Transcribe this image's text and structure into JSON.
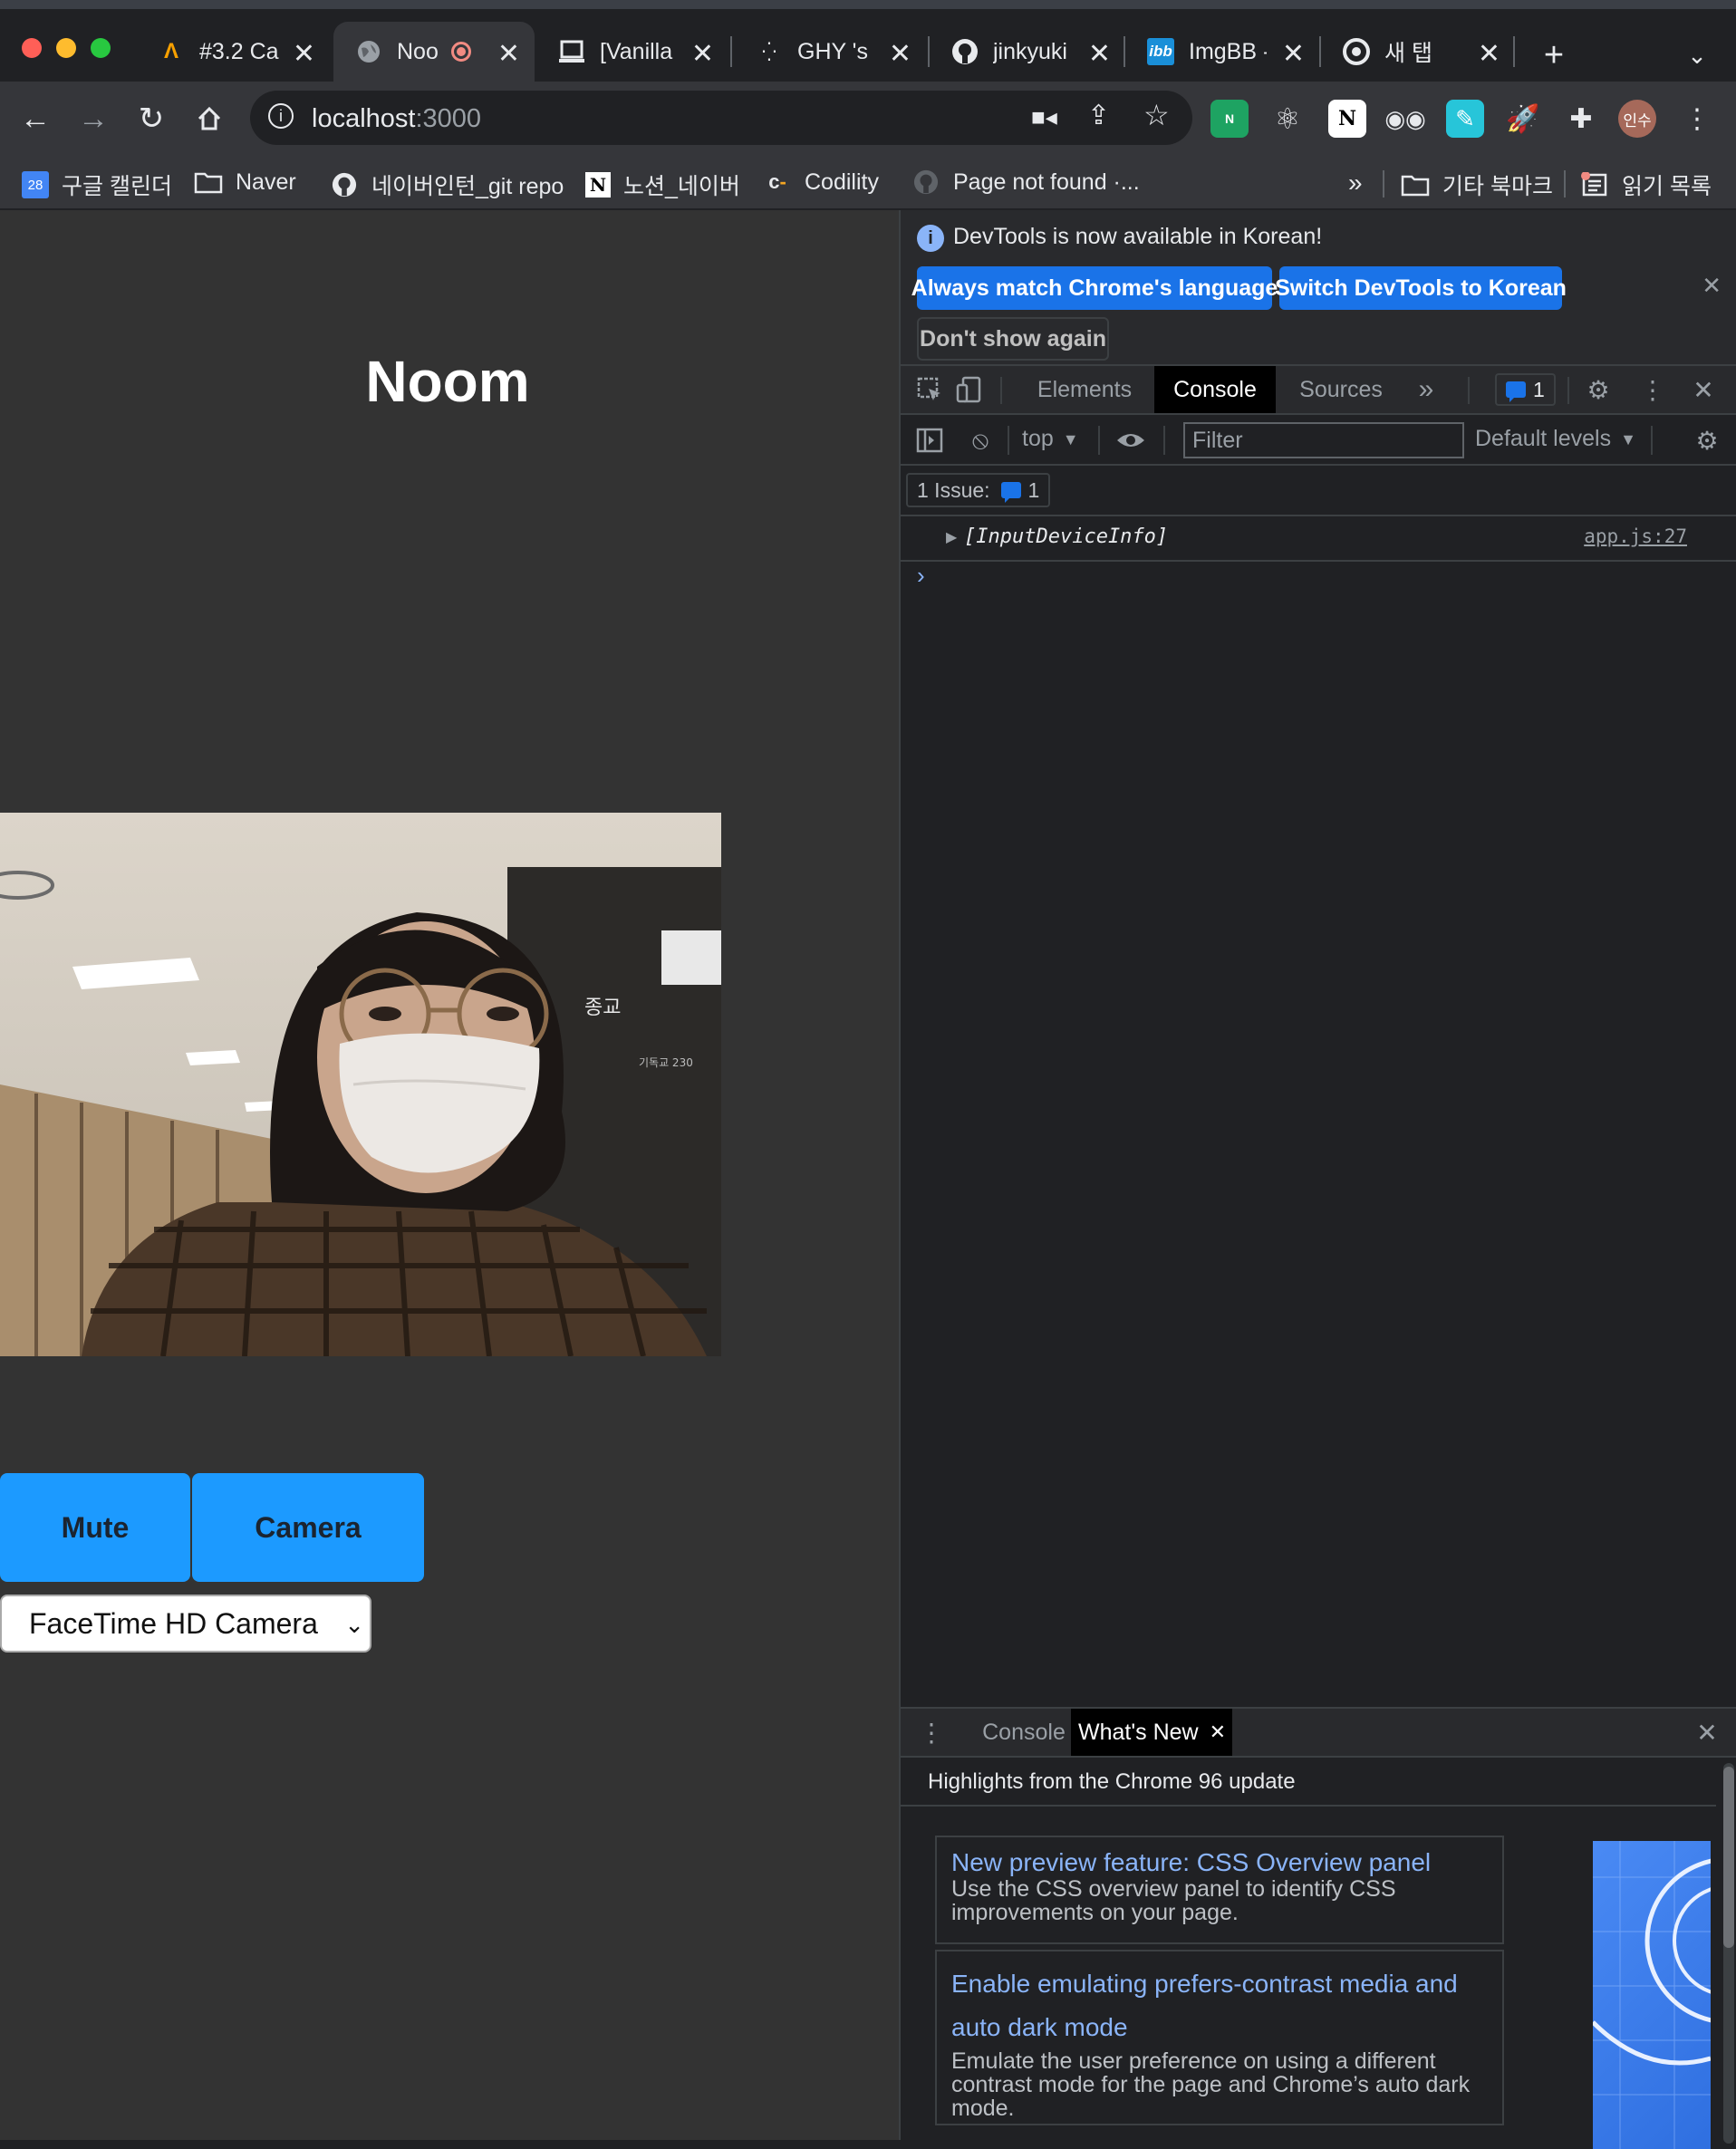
{
  "browser": {
    "tabs": [
      {
        "title": "#3.2 Ca",
        "icon": "m-logo-icon"
      },
      {
        "title": "Noo",
        "icon": "globe-icon",
        "active": true
      },
      {
        "title": "[Vanilla",
        "icon": "laptop-icon"
      },
      {
        "title": "GHY 's",
        "icon": "dots-icon"
      },
      {
        "title": "jinkyuki",
        "icon": "github-icon"
      },
      {
        "title": "ImgBB -",
        "icon": "ibb-icon"
      },
      {
        "title": "새 탭",
        "icon": "chrome-icon"
      }
    ],
    "new_tab_symbol": "+",
    "close_symbol": "✕",
    "url_host": "localhost",
    "url_rest": ":3000",
    "profile_label": "인수",
    "bookmarks": [
      {
        "label": "구글 캘린더",
        "icon": "calendar-icon"
      },
      {
        "label": "Naver",
        "icon": "folder-icon"
      },
      {
        "label": "네이버인턴_git repo",
        "icon": "github-icon"
      },
      {
        "label": "노션_네이버",
        "icon": "notion-icon"
      },
      {
        "label": "Codility",
        "icon": "codility-icon"
      },
      {
        "label": "Page not found ·...",
        "icon": "github-icon"
      }
    ],
    "bookmarks_more": "»",
    "other_bookmarks": "기타 북마크",
    "reading_list": "읽기 목록",
    "calendar_day": "28"
  },
  "page": {
    "title": "Noom",
    "mute_label": "Mute",
    "camera_label": "Camera",
    "camera_select_value": "FaceTime HD Camera",
    "camera_options": [
      "FaceTime HD Camera"
    ],
    "video_sign_text": "종교",
    "video_sign_sub": "기독교 230"
  },
  "devtools": {
    "info_text": "DevTools is now available in Korean!",
    "btn_match": "Always match Chrome's language",
    "btn_switch": "Switch DevTools to Korean",
    "btn_dont_show": "Don't show again",
    "tabs": {
      "elements": "Elements",
      "console": "Console",
      "sources": "Sources"
    },
    "issues_count": "1",
    "context": "top",
    "filter_placeholder": "Filter",
    "levels": "Default levels",
    "issues_label": "1 Issue:",
    "log_text": "[InputDeviceInfo]",
    "log_source": "app.js:27",
    "prompt": "›",
    "drawer": {
      "tab_console": "Console",
      "tab_whats_new": "What's New",
      "heading": "Highlights from the Chrome 96 update",
      "cards": [
        {
          "title": "New preview feature: CSS Overview panel",
          "desc": "Use the CSS overview panel to identify CSS improvements on your page."
        },
        {
          "title": "Enable emulating prefers-contrast media and auto dark mode",
          "desc": "Emulate the user preference on using a different contrast mode for the page and Chrome’s auto dark mode."
        }
      ]
    }
  },
  "colors": {
    "accent_button": "#1c9aff",
    "page_bg": "#333333",
    "devtools_bg": "#202124",
    "link": "#8ab4f8"
  }
}
